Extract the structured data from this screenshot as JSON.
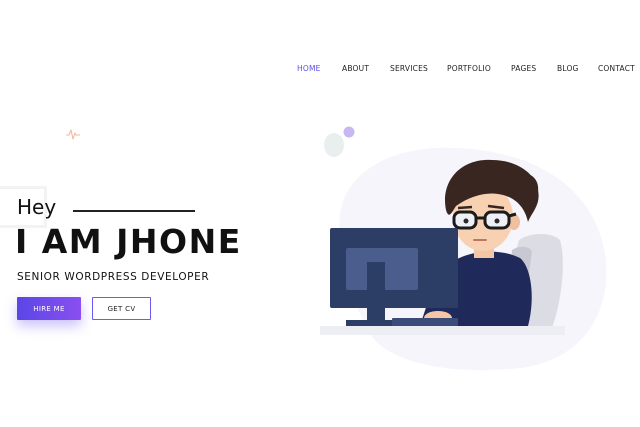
{
  "nav": {
    "items": [
      {
        "label": "HOME",
        "active": true
      },
      {
        "label": "ABOUT",
        "active": false
      },
      {
        "label": "SERVICES",
        "active": false
      },
      {
        "label": "PORTFOLIO",
        "active": false
      },
      {
        "label": "PAGES",
        "active": false
      },
      {
        "label": "BLOG",
        "active": false
      },
      {
        "label": "CONTACT",
        "active": false
      }
    ]
  },
  "hero": {
    "greeting": "Hey",
    "headline": "I AM JHONE",
    "subtitle": "SENIOR WORDPRESS DEVELOPER",
    "hire_label": "HIRE ME",
    "cv_label": "GET CV"
  },
  "colors": {
    "accent": "#5a4fe8",
    "button_gradient_start": "#5b46e6",
    "button_gradient_end": "#8a4ff0",
    "monitor": "#2c3e66",
    "shirt": "#1f2a5a"
  },
  "icons": {
    "sparkle": "sparkle-icon",
    "illustration": "developer-at-computer-illustration"
  }
}
